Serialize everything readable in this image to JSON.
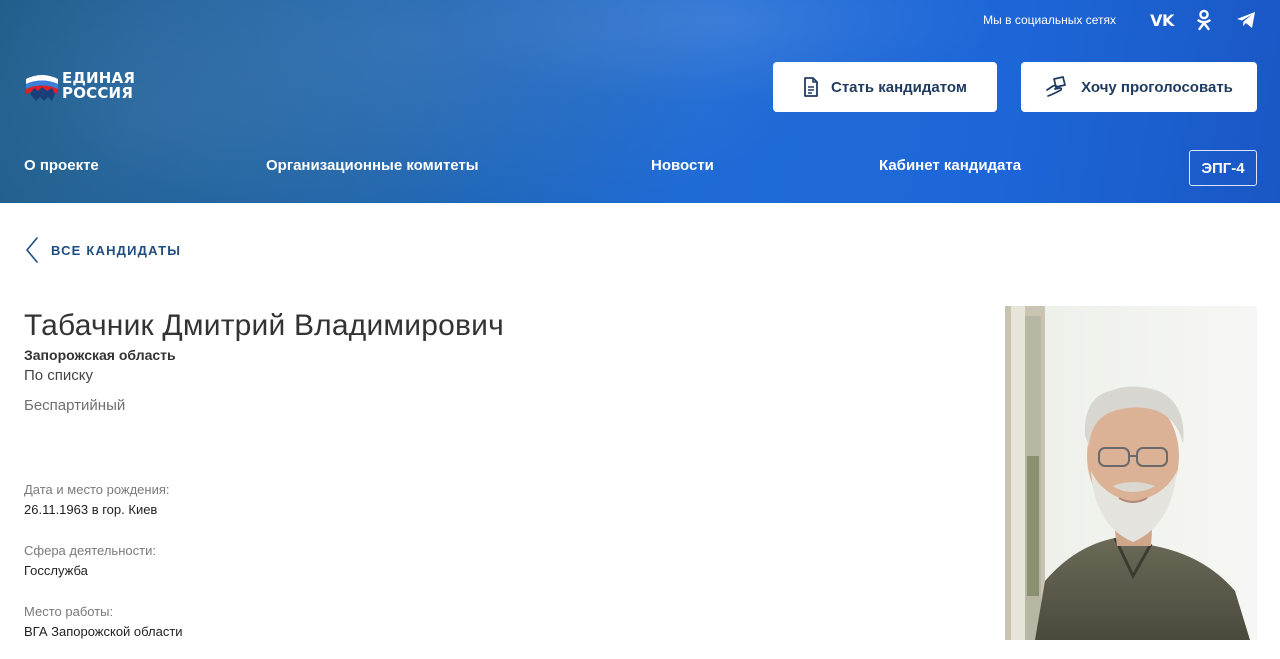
{
  "header": {
    "social_label": "Мы в социальных сетях",
    "social_icons": [
      "vk-icon",
      "odnoklassniki-icon",
      "telegram-icon"
    ],
    "social_vk_text": "VK",
    "logo": {
      "line1": "ЕДИНАЯ",
      "line2": "РОССИЯ"
    },
    "buttons": {
      "become_candidate": "Стать кандидатом",
      "want_vote": "Хочу проголосовать"
    },
    "nav": {
      "about": "О проекте",
      "committees": "Организационные комитеты",
      "news": "Новости",
      "cabinet": "Кабинет кандидата"
    },
    "epg_label": "ЭПГ-4"
  },
  "content": {
    "back_label": "ВСЕ КАНДИДАТЫ",
    "candidate": {
      "full_name": "Табачник Дмитрий Владимирович",
      "region": "Запорожская область",
      "list_type": "По списку",
      "party": "Беспартийный",
      "fields": [
        {
          "label": "Дата и место рождения:",
          "value": "26.11.1963 в гор. Киев"
        },
        {
          "label": "Сфера деятельности:",
          "value": "Госслужба"
        },
        {
          "label": "Место работы:",
          "value": "ВГА Запорожской области"
        }
      ]
    }
  },
  "colors": {
    "header_blue": "#1f6bd6",
    "button_text": "#1e3a5f",
    "back_link": "#1f4d80",
    "logo_red": "#e31e24"
  }
}
